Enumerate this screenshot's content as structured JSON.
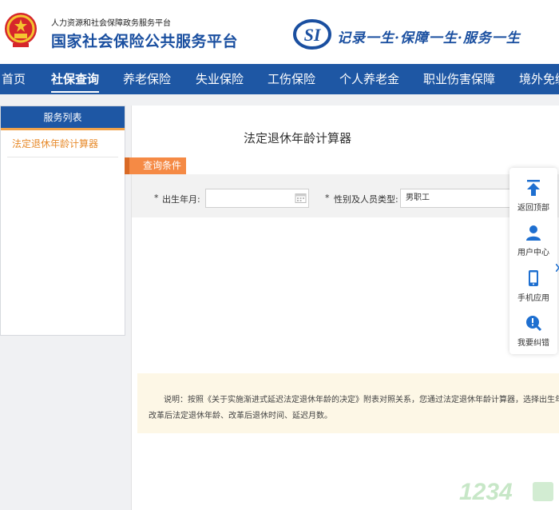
{
  "header": {
    "org_name": "人力资源和社会保障政务服务平台",
    "site_title": "国家社会保险公共服务平台",
    "logo_text": "SI",
    "slogan": "记录一生·保障一生·服务一生"
  },
  "nav": {
    "items": [
      "首页",
      "社保查询",
      "养老保险",
      "失业保险",
      "工伤保险",
      "个人养老金",
      "职业伤害保障",
      "境外免缴"
    ],
    "active_index": 1
  },
  "sidebar": {
    "title": "服务列表",
    "items": [
      "法定退休年龄计算器"
    ]
  },
  "main": {
    "heading": "法定退休年龄计算器",
    "conditions_tag": "查询条件",
    "birth_label": "出生年月:",
    "birth_value": "",
    "type_label": "性别及人员类型:",
    "type_value": "男职工",
    "required_mark": "*",
    "note_line1": "说明：按照《关于实施渐进式延迟法定退休年龄的决定》附表对照关系，您通过法定退休年龄计算器，选择出生年月",
    "note_line2": "改革后法定退休年龄、改革后退休时间、延迟月数。"
  },
  "float_bar": {
    "items": [
      {
        "label": "返回顶部",
        "icon": "arrow-up-icon"
      },
      {
        "label": "用户中心",
        "icon": "user-icon"
      },
      {
        "label": "手机应用",
        "icon": "phone-icon"
      },
      {
        "label": "我要纠错",
        "icon": "error-report-icon"
      }
    ]
  },
  "watermark": {
    "text": "1234"
  },
  "colors": {
    "brand_blue": "#1e57a4",
    "accent_orange": "#f58a45",
    "note_bg": "#fdf7e6",
    "link_orange": "#e78a2a"
  }
}
